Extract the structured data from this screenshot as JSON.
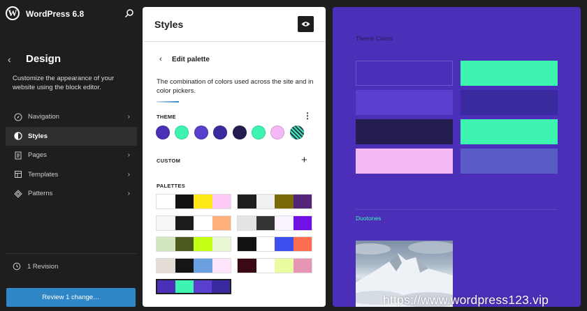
{
  "app": {
    "title": "WordPress 6.8",
    "logo_letter": "W"
  },
  "sidebar": {
    "section_title": "Design",
    "description": "Customize the appearance of your website using the block editor.",
    "nav": [
      {
        "label": "Navigation",
        "icon": "navigation-icon",
        "chevron": true,
        "active": false
      },
      {
        "label": "Styles",
        "icon": "styles-icon",
        "chevron": false,
        "active": true
      },
      {
        "label": "Pages",
        "icon": "pages-icon",
        "chevron": true,
        "active": false
      },
      {
        "label": "Templates",
        "icon": "templates-icon",
        "chevron": true,
        "active": false
      },
      {
        "label": "Patterns",
        "icon": "patterns-icon",
        "chevron": true,
        "active": false
      }
    ],
    "revisions": "1 Revision",
    "review_button": "Review 1 change…"
  },
  "styles_panel": {
    "title": "Styles",
    "edit_palette_title": "Edit palette",
    "description": "The combination of colors used across the site and in color pickers.",
    "theme_label": "THEME",
    "custom_label": "CUSTOM",
    "palettes_label": "PALETTES",
    "theme_swatches": [
      "#4b2fb8",
      "#3df5b1",
      "#5a3fcf",
      "#3a2aa0",
      "#241d4f",
      "#3df5b1",
      "#f4b8f6",
      "hatch"
    ],
    "palettes": [
      [
        "#ffffff",
        "#111111",
        "#ffe81a",
        "#fcc8f4"
      ],
      [
        "#1e1e1e",
        "#f0f0f0",
        "#7a6a08",
        "#532478"
      ],
      [
        "#f6f6f6",
        "#1c1c1c",
        "#ffffff",
        "#ffb07a"
      ],
      [
        "#e4e4e4",
        "#333333",
        "#fbf2ff",
        "#7012e4"
      ],
      [
        "#d2e6c0",
        "#4c5a1e",
        "#c2ff12",
        "#e8f6d4"
      ],
      [
        "#111111",
        "#ffffff",
        "#3e4ff0",
        "#ff6e50"
      ],
      [
        "#e3ddd6",
        "#151515",
        "#6aa0e0",
        "#fde4fb"
      ],
      [
        "#3a0a14",
        "#ffffff",
        "#eafca0",
        "#e696b4"
      ],
      [
        "#4b2fb8",
        "#3df5b1",
        "#5a3fcf",
        "#3a2aa0"
      ]
    ]
  },
  "preview": {
    "theme_colors_label": "Theme Colors",
    "duotones_label": "Duotones",
    "color_blocks": [
      [
        "#4b2fb8",
        "#3df5b1"
      ],
      [
        "#5a3fcf",
        "#3a2aa0"
      ],
      [
        "#241d4f",
        "#3df5b1"
      ],
      [
        "#f4b8f6",
        "#5a5cc6"
      ]
    ]
  },
  "watermark": "https://www.wordpress123.vip",
  "colors": {
    "accent": "#2f87c7",
    "sidebar_bg": "#1e1e1e",
    "preview_bg": "#4b2fb8"
  }
}
